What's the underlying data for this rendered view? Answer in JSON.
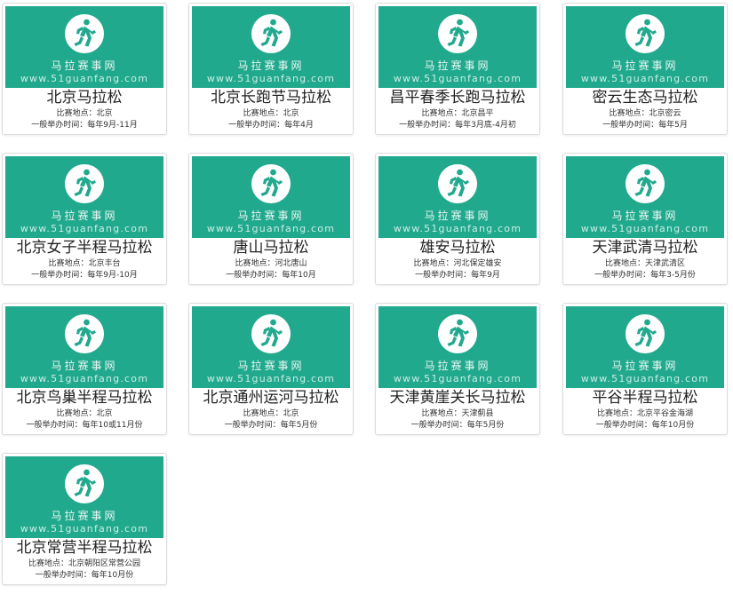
{
  "brand": "马拉赛事网",
  "site": "www.51guanfang.com",
  "location_label": "比赛地点：",
  "time_label": "一般举办时间：",
  "accent_color": "#21a98d",
  "icon": "runner-icon",
  "races": [
    {
      "name": "北京马拉松",
      "location": "北京",
      "time": "每年9月-11月"
    },
    {
      "name": "北京长跑节马拉松",
      "location": "北京",
      "time": "每年4月"
    },
    {
      "name": "昌平春季长跑马拉松",
      "location": "北京昌平",
      "time": "每年3月底-4月初"
    },
    {
      "name": "密云生态马拉松",
      "location": "北京密云",
      "time": "每年5月"
    },
    {
      "name": "北京女子半程马拉松",
      "location": "北京丰台",
      "time": "每年9月-10月"
    },
    {
      "name": "唐山马拉松",
      "location": "河北唐山",
      "time": "每年10月"
    },
    {
      "name": "雄安马拉松",
      "location": "河北保定雄安",
      "time": "每年9月"
    },
    {
      "name": "天津武清马拉松",
      "location": "天津武清区",
      "time": "每年3-5月份"
    },
    {
      "name": "北京鸟巢半程马拉松",
      "location": "北京",
      "time": "每年10或11月份"
    },
    {
      "name": "北京通州运河马拉松",
      "location": "北京",
      "time": "每年5月份"
    },
    {
      "name": "天津黄崖关长马拉松",
      "location": "天津蓟县",
      "time": "每年5月份"
    },
    {
      "name": "平谷半程马拉松",
      "location": "北京平谷金海湖",
      "time": "每年10月份"
    },
    {
      "name": "北京常营半程马拉松",
      "location": "北京朝阳区常营公园",
      "time": "每年10月份"
    }
  ]
}
